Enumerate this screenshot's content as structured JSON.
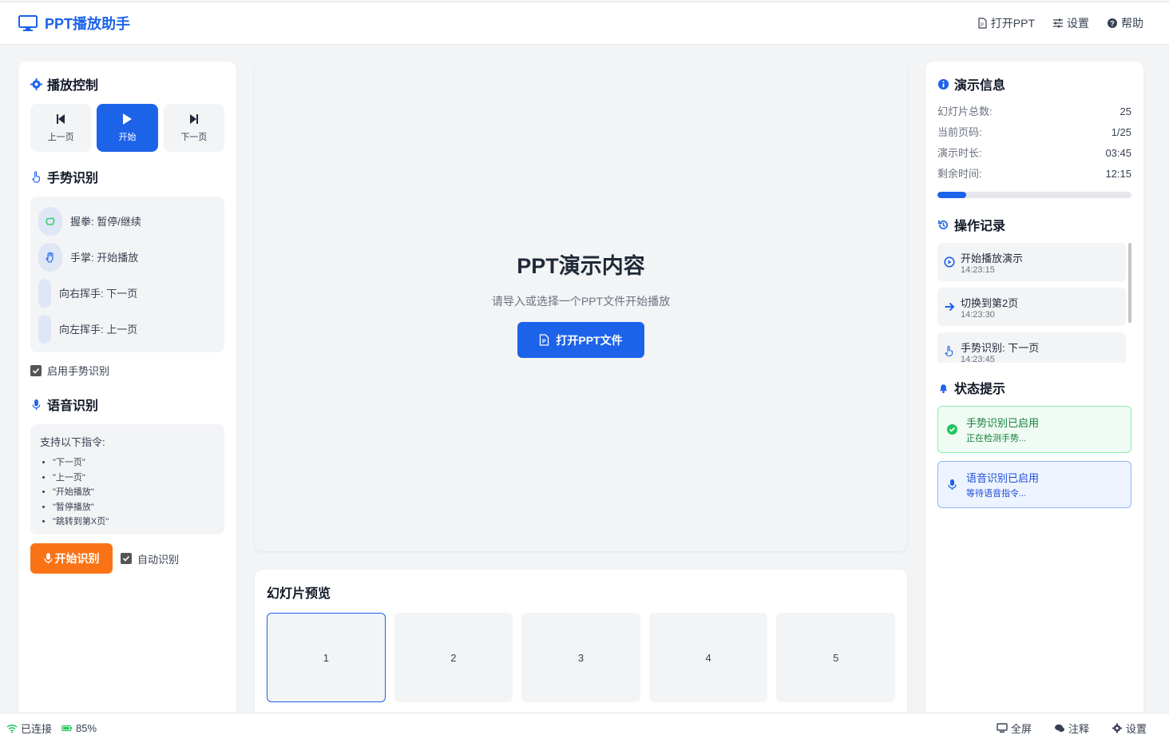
{
  "app": {
    "title": "PPT播放助手"
  },
  "header": {
    "open_ppt": "打开PPT",
    "settings": "设置",
    "help": "帮助"
  },
  "playback": {
    "title": "播放控制",
    "prev": "上一页",
    "start": "开始",
    "next": "下一页"
  },
  "gesture": {
    "title": "手势识别",
    "items": [
      {
        "label": "握拳: 暂停/继续",
        "icon": "fist-icon"
      },
      {
        "label": "手掌: 开始播放",
        "icon": "palm-icon"
      },
      {
        "label": "向右挥手: 下一页",
        "icon": ""
      },
      {
        "label": "向左挥手: 上一页",
        "icon": ""
      }
    ],
    "enable_label": "启用手势识别",
    "enabled": true
  },
  "voice": {
    "title": "语音识别",
    "intro": "支持以下指令:",
    "commands": [
      "\"下一页\"",
      "\"上一页\"",
      "\"开始播放\"",
      "\"暂停播放\"",
      "\"跳转到第X页\""
    ],
    "start_label": "开始识别",
    "auto_label": "自动识别",
    "auto_enabled": true
  },
  "stage": {
    "title": "PPT演示内容",
    "subtitle": "请导入或选择一个PPT文件开始播放",
    "open_button": "打开PPT文件"
  },
  "preview": {
    "title": "幻灯片预览",
    "slides": [
      "1",
      "2",
      "3",
      "4",
      "5"
    ],
    "active_index": 0
  },
  "info": {
    "title": "演示信息",
    "rows": [
      {
        "k": "幻灯片总数:",
        "v": "25"
      },
      {
        "k": "当前页码:",
        "v": "1/25"
      },
      {
        "k": "演示时长:",
        "v": "03:45"
      },
      {
        "k": "剩余时间:",
        "v": "12:15"
      }
    ],
    "progress_fraction": 0.15
  },
  "log": {
    "title": "操作记录",
    "items": [
      {
        "text": "开始播放演示",
        "time": "14:23:15",
        "icon": "play-circle-icon"
      },
      {
        "text": "切换到第2页",
        "time": "14:23:30",
        "icon": "arrow-right-icon"
      },
      {
        "text": "手势识别: 下一页",
        "time": "14:23:45",
        "icon": "hand-pointer-icon"
      }
    ]
  },
  "status": {
    "title": "状态提示",
    "items": [
      {
        "title": "手势识别已启用",
        "sub": "正在检测手势...",
        "type": "success",
        "color": "#15803d"
      },
      {
        "title": "语音识别已启用",
        "sub": "等待语音指令...",
        "type": "info",
        "color": "#1d4ed8"
      }
    ]
  },
  "bottom": {
    "connection": "已连接",
    "battery": "85%",
    "fullscreen": "全屏",
    "notes": "注释",
    "settings": "设置"
  },
  "colors": {
    "primary": "#1d63ea",
    "accent": "#f97316",
    "success": "#22c55e"
  }
}
